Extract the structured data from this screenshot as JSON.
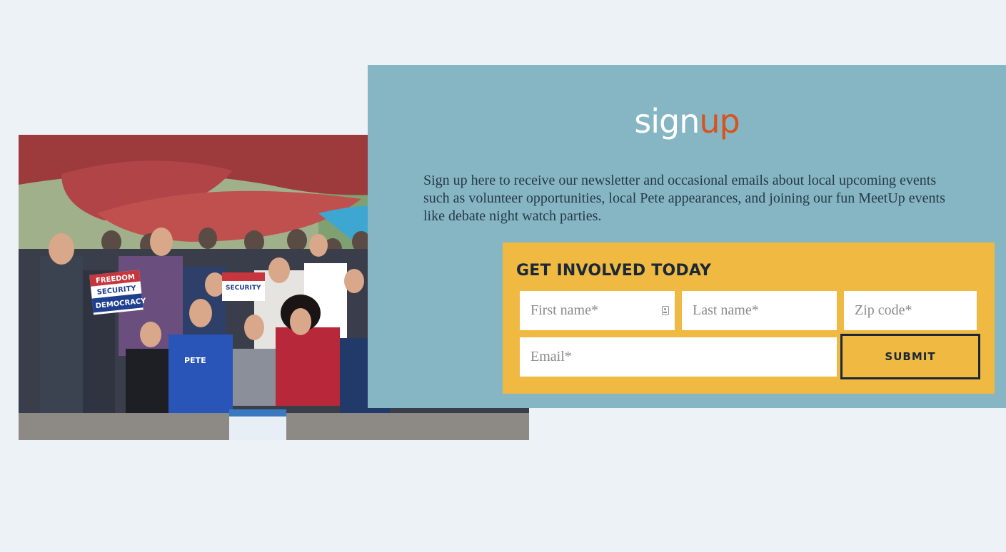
{
  "logo": {
    "part1": "sign",
    "part2": "up"
  },
  "intro_text": "Sign up here to receive our newsletter and occasional emails about local upcoming events such as volunteer opportunities, local Pete appearances, and joining our fun MeetUp events like debate night watch parties.",
  "form": {
    "title": "GET INVOLVED TODAY",
    "first_name_placeholder": "First name*",
    "last_name_placeholder": "Last name*",
    "zip_placeholder": "Zip code*",
    "email_placeholder": "Email*",
    "submit_label": "SUBMIT"
  },
  "photo": {
    "signs": [
      "FREEDOM",
      "SECURITY",
      "DEMOCRACY"
    ],
    "shirt_text": "PETE"
  },
  "colors": {
    "background": "#edf2f6",
    "panel": "#86b6c4",
    "form_box": "#f0b941",
    "accent": "#d7531f",
    "text_dark": "#1b2838"
  },
  "icons": {
    "autofill": "contact-card-icon"
  }
}
